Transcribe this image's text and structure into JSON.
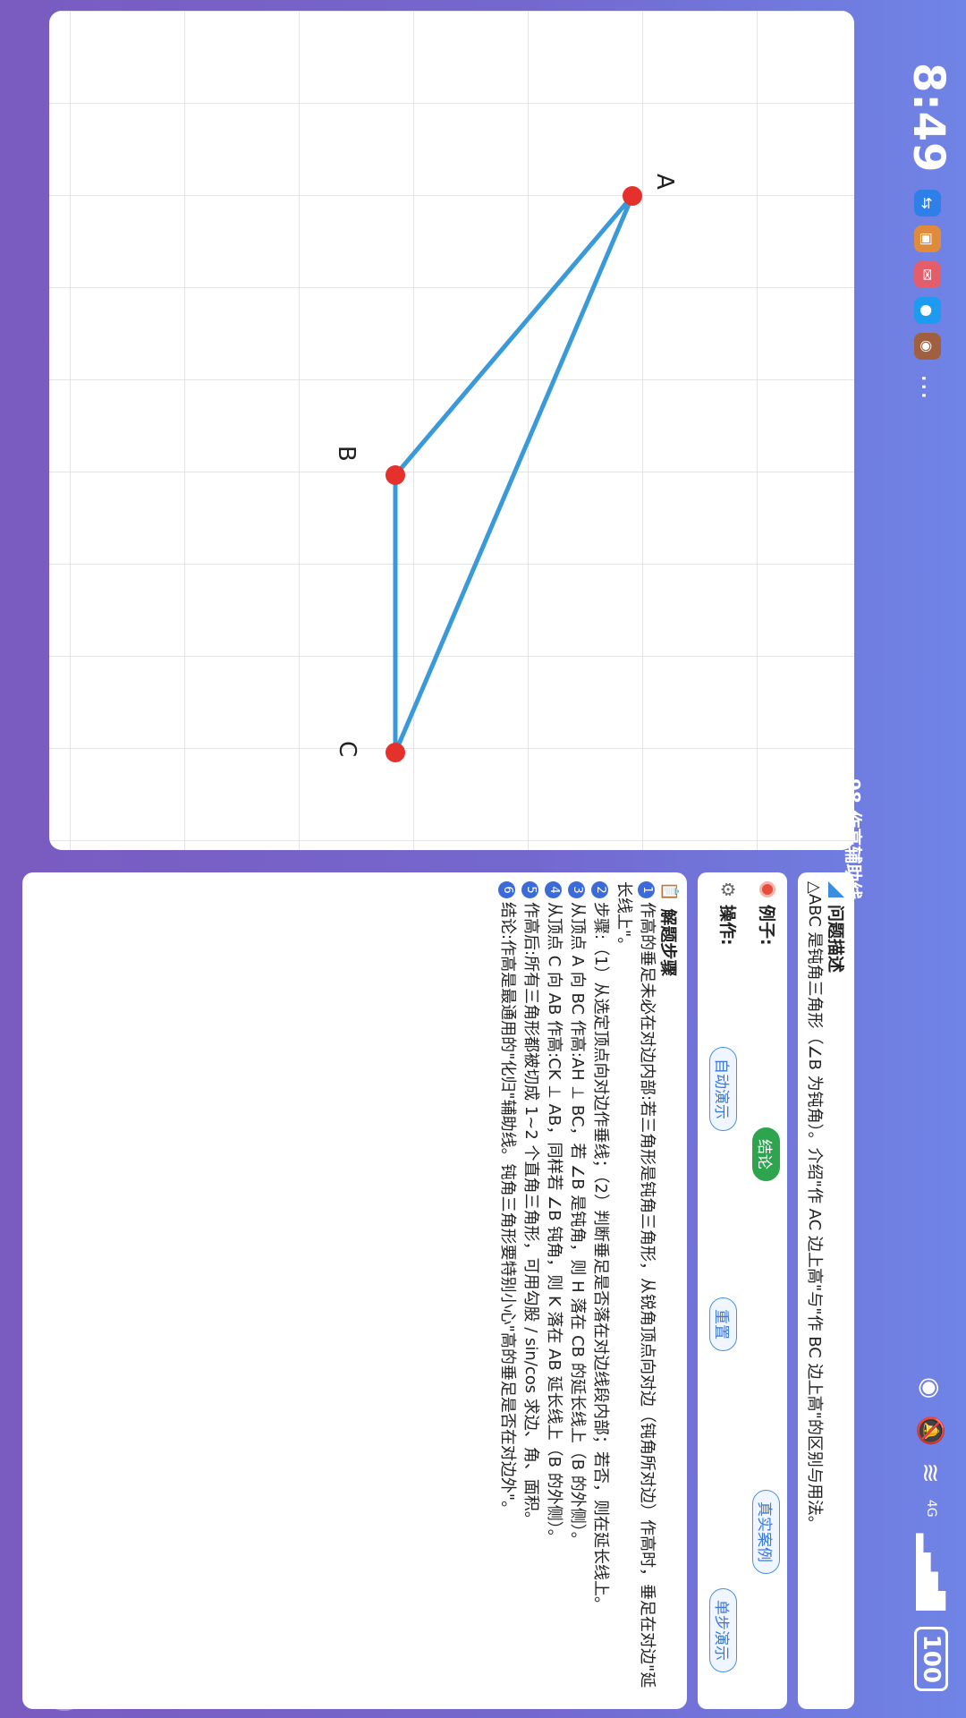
{
  "status": {
    "time": "8:49",
    "network": "4G",
    "battery": "100",
    "more": "..."
  },
  "app": {
    "title": "98.作高辅助线"
  },
  "problem": {
    "heading": "问题描述",
    "text": "△ABC 是钝角三角形（∠B 为钝角）。介绍\"作 AC 边上高\"与\"作 BC 边上高\"的区别与用法。"
  },
  "examples": {
    "label": "例子:",
    "buttons": [
      "结论",
      "真实案例"
    ]
  },
  "operations": {
    "label": "操作:",
    "buttons": [
      "自动演示",
      "重置",
      "单步演示"
    ]
  },
  "steps": {
    "heading": "解题步骤",
    "items": [
      {
        "num": "1",
        "text": "作高的垂足未必在对边内部:若三角形是钝角三角形，从锐角顶点向对边（钝角所对边）作高时，垂足在对边\"延长线上\"。"
      },
      {
        "num": "2",
        "text": "步骤:（1）从选定顶点向对边作垂线；（2）判断垂足是否落在对边线段内部；若否，则在延长线上。"
      },
      {
        "num": "3",
        "text": "从顶点 A 向 BC 作高:AH ⊥ BC，若 ∠B 是钝角，则 H 落在 CB 的延长线上（B 的外侧）。"
      },
      {
        "num": "4",
        "text": "从顶点 C 向 AB 作高:CK ⊥ AB，同样若 ∠B 钝角，则 K 落在 AB 延长线上（B 的外侧）。"
      },
      {
        "num": "5",
        "text": "作高后:所有三角形都被切成 1~2 个直角三角形，可用勾股 / sin/cos 求边、角、面积。"
      },
      {
        "num": "6",
        "text": "结论:作高是最通用的\"化归\"辅助线。钝角三角形要特别小心\"高的垂足是否在对边外\"。"
      }
    ]
  },
  "canvas": {
    "points": [
      {
        "label": "A"
      },
      {
        "label": "B"
      },
      {
        "label": "C"
      }
    ],
    "line_color": "#3a9ad9",
    "point_color": "#e5302b"
  }
}
